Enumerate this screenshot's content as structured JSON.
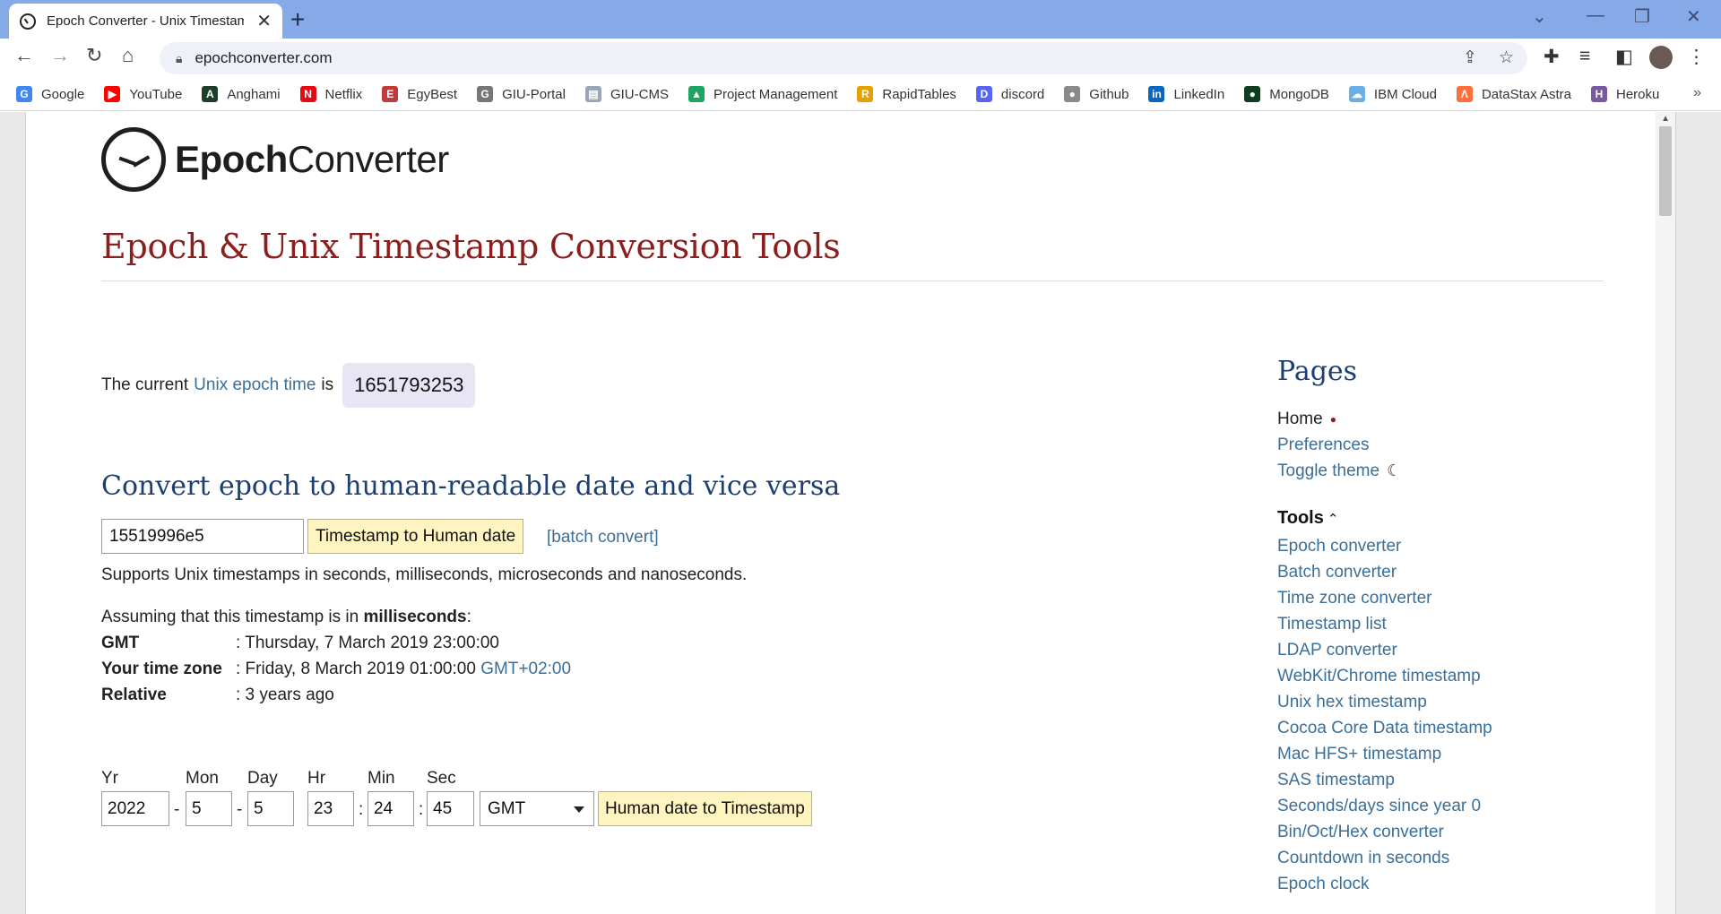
{
  "browser": {
    "tab_title": "Epoch Converter - Unix Timestamp",
    "url": "epochconverter.com",
    "bookmarks": [
      {
        "label": "Google",
        "icon": "google-icon",
        "color": "#4285f4",
        "glyph": "G"
      },
      {
        "label": "YouTube",
        "icon": "youtube-icon",
        "color": "#ff0000",
        "glyph": "▶"
      },
      {
        "label": "Anghami",
        "icon": "anghami-icon",
        "color": "#1f3d2b",
        "glyph": "A"
      },
      {
        "label": "Netflix",
        "icon": "netflix-icon",
        "color": "#e50914",
        "glyph": "N"
      },
      {
        "label": "EgyBest",
        "icon": "egybest-icon",
        "color": "#c23b3b",
        "glyph": "E"
      },
      {
        "label": "GIU-Portal",
        "icon": "giu-portal-icon",
        "color": "#777777",
        "glyph": "G"
      },
      {
        "label": "GIU-CMS",
        "icon": "giu-cms-icon",
        "color": "#9aa6b8",
        "glyph": "▤"
      },
      {
        "label": "Project Management",
        "icon": "google-drive-icon",
        "color": "#1fa463",
        "glyph": "▲"
      },
      {
        "label": "RapidTables",
        "icon": "rapidtables-icon",
        "color": "#e8a000",
        "glyph": "R"
      },
      {
        "label": "discord",
        "icon": "discord-icon",
        "color": "#5865f2",
        "glyph": "D"
      },
      {
        "label": "Github",
        "icon": "github-icon",
        "color": "#8a8a8a",
        "glyph": "●"
      },
      {
        "label": "LinkedIn",
        "icon": "linkedin-icon",
        "color": "#0a66c2",
        "glyph": "in"
      },
      {
        "label": "MongoDB",
        "icon": "mongodb-icon",
        "color": "#0f3d22",
        "glyph": "●"
      },
      {
        "label": "IBM Cloud",
        "icon": "ibm-cloud-icon",
        "color": "#6ab0e8",
        "glyph": "☁"
      },
      {
        "label": "DataStax Astra",
        "icon": "datastax-icon",
        "color": "#ff6f3c",
        "glyph": "Λ"
      },
      {
        "label": "Heroku",
        "icon": "heroku-icon",
        "color": "#79589f",
        "glyph": "H"
      }
    ]
  },
  "site": {
    "logo_bold": "Epoch",
    "logo_rest": "Converter",
    "title": "Epoch & Unix Timestamp Conversion Tools"
  },
  "current": {
    "prefix": "The current",
    "link": "Unix epoch time",
    "suffix": "is",
    "value": "1651793253"
  },
  "converter": {
    "heading": "Convert epoch to human-readable date and vice versa",
    "input_value": "15519996e5",
    "button_label": "Timestamp to Human date",
    "batch_link": "[batch convert]",
    "supports_text": "Supports Unix timestamps in seconds, milliseconds, microseconds and nanoseconds.",
    "assuming_prefix": "Assuming that this timestamp is in",
    "assuming_unit": "milliseconds",
    "assuming_suffix": ":",
    "results": [
      {
        "key": "GMT",
        "value": ": Thursday, 7 March 2019 23:00:00",
        "tz": ""
      },
      {
        "key": "Your time zone",
        "value": ": Friday, 8 March 2019 01:00:00",
        "tz": "GMT+02:00"
      },
      {
        "key": "Relative",
        "value": ": 3 years ago",
        "tz": ""
      }
    ]
  },
  "date_form": {
    "labels": {
      "yr": "Yr",
      "mon": "Mon",
      "day": "Day",
      "hr": "Hr",
      "min": "Min",
      "sec": "Sec"
    },
    "values": {
      "yr": "2022",
      "mon": "5",
      "day": "5",
      "hr": "23",
      "min": "24",
      "sec": "45"
    },
    "timezone": "GMT",
    "button_label": "Human date to Timestamp"
  },
  "sidebar": {
    "pages_title": "Pages",
    "home": "Home",
    "preferences": "Preferences",
    "toggle_theme": "Toggle theme",
    "tools_title": "Tools",
    "tools": [
      "Epoch converter",
      "Batch converter",
      "Time zone converter",
      "Timestamp list",
      "LDAP converter",
      "WebKit/Chrome timestamp",
      "Unix hex timestamp",
      "Cocoa Core Data timestamp",
      "Mac HFS+ timestamp",
      "SAS timestamp",
      "Seconds/days since year 0",
      "Bin/Oct/Hex converter",
      "Countdown in seconds",
      "Epoch clock"
    ]
  }
}
